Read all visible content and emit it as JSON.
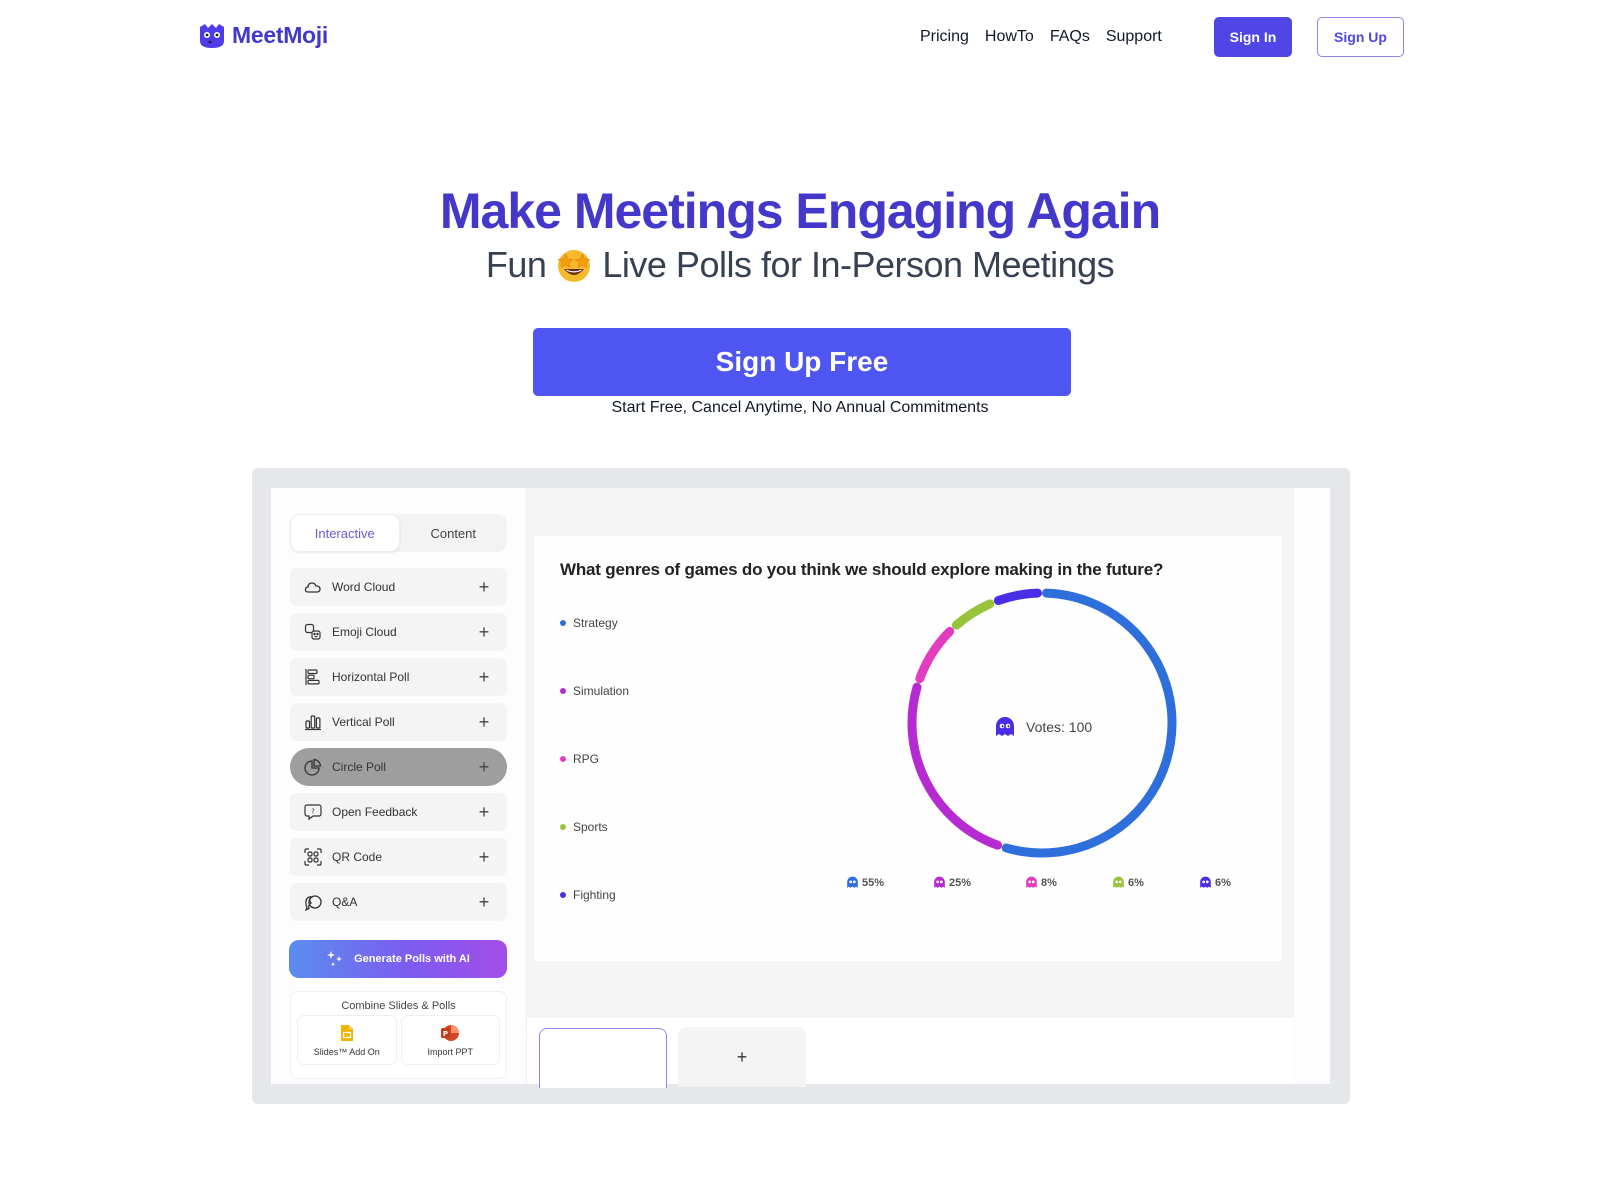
{
  "header": {
    "brand": "MeetMoji",
    "nav": [
      "Pricing",
      "HowTo",
      "FAQs",
      "Support"
    ],
    "sign_in": "Sign In",
    "sign_up": "Sign Up"
  },
  "hero": {
    "title": "Make Meetings Engaging Again",
    "subtitle_before": "Fun",
    "subtitle_emoji": "star-struck-emoji",
    "subtitle_after": "Live Polls for In-Person Meetings",
    "cta": "Sign Up Free",
    "cta_note": "Start Free, Cancel Anytime, No Annual Commitments"
  },
  "preview": {
    "tabs": [
      "Interactive",
      "Content"
    ],
    "active_tab": "Interactive",
    "items": [
      {
        "label": "Word Cloud",
        "icon": "cloud-icon"
      },
      {
        "label": "Emoji Cloud",
        "icon": "emoji-cloud-icon"
      },
      {
        "label": "Horizontal Poll",
        "icon": "horizontal-bars-icon"
      },
      {
        "label": "Vertical Poll",
        "icon": "vertical-bars-icon"
      },
      {
        "label": "Circle Poll",
        "icon": "pie-icon",
        "active": true
      },
      {
        "label": "Open Feedback",
        "icon": "question-bubble-icon"
      },
      {
        "label": "QR Code",
        "icon": "qr-icon"
      },
      {
        "label": "Q&A",
        "icon": "chat-bubbles-icon"
      }
    ],
    "ai_button": "Generate Polls with AI",
    "combine": {
      "title": "Combine Slides & Polls",
      "cards": [
        "Slides™ Add On",
        "Import PPT"
      ]
    },
    "poll": {
      "question": "What genres of games do you think we should explore making in the future?",
      "votes_label": "Votes: 100"
    },
    "add_slide": "+"
  },
  "chart_data": {
    "type": "pie",
    "variant": "donut",
    "title": "What genres of games do you think we should explore making in the future?",
    "total_votes": 100,
    "categories": [
      "Strategy",
      "Simulation",
      "RPG",
      "Sports",
      "Fighting"
    ],
    "values": [
      55,
      25,
      8,
      6,
      6
    ],
    "labels": [
      "55%",
      "25%",
      "8%",
      "6%",
      "6%"
    ],
    "colors": [
      "#2f6fdc",
      "#b62bd1",
      "#e33dbf",
      "#98c43b",
      "#4a2ee6"
    ],
    "legend": "left"
  }
}
